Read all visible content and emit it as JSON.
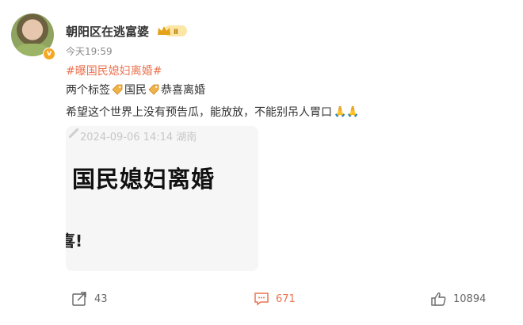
{
  "post": {
    "username": "朝阳区在逃富婆",
    "member_badge": "Ⅱ",
    "verified_mark": "v",
    "timestamp": "今天19:59",
    "hashtag": "#曝国民媳妇离婚#",
    "line1": {
      "prefix": "两个标签",
      "tag1": "国民",
      "tag2": "恭喜离婚"
    },
    "line2": "希望这个世界上没有预告瓜，能放放，不能别吊人胃口"
  },
  "image_card": {
    "date_overlay": "2024-09-06 14:14  湖南",
    "headline": "国民媳妇离婚",
    "tail_fragment": "喜!"
  },
  "actions": {
    "share_count": "43",
    "comment_count": "671",
    "like_count": "10894"
  },
  "colors": {
    "accent": "#eb7350",
    "text": "#333333",
    "muted": "#8a8a8a",
    "badge": "#f5a623"
  }
}
